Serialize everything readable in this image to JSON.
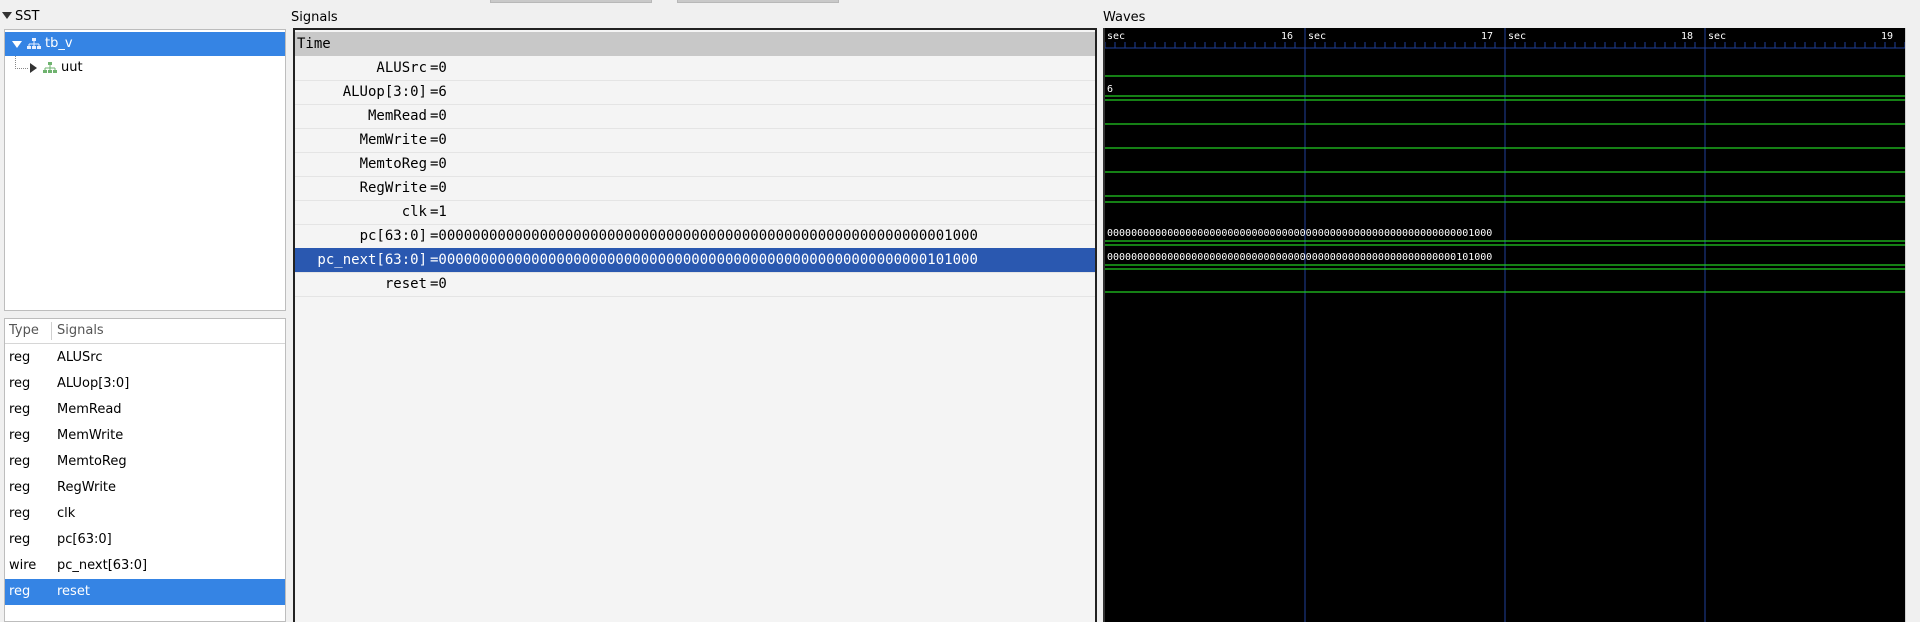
{
  "sst": {
    "title": "SST",
    "tree": [
      {
        "label": "tb_v",
        "selected": true,
        "expanded": true
      },
      {
        "label": "uut",
        "selected": false,
        "expanded": false
      }
    ]
  },
  "signal_list": {
    "col_type": "Type",
    "col_signals": "Signals",
    "rows": [
      {
        "type": "reg",
        "name": "ALUSrc"
      },
      {
        "type": "reg",
        "name": "ALUop[3:0]"
      },
      {
        "type": "reg",
        "name": "MemRead"
      },
      {
        "type": "reg",
        "name": "MemWrite"
      },
      {
        "type": "reg",
        "name": "MemtoReg"
      },
      {
        "type": "reg",
        "name": "RegWrite"
      },
      {
        "type": "reg",
        "name": "clk"
      },
      {
        "type": "reg",
        "name": "pc[63:0]"
      },
      {
        "type": "wire",
        "name": "pc_next[63:0]"
      },
      {
        "type": "reg",
        "name": "reset",
        "selected": true
      }
    ]
  },
  "signals_pane": {
    "label": "Signals",
    "time_label": "Time",
    "rows": [
      {
        "name": "ALUSrc",
        "value": "=0"
      },
      {
        "name": "ALUop[3:0]",
        "value": "=6"
      },
      {
        "name": "MemRead",
        "value": "=0"
      },
      {
        "name": "MemWrite",
        "value": "=0"
      },
      {
        "name": "MemtoReg",
        "value": "=0"
      },
      {
        "name": "RegWrite",
        "value": "=0"
      },
      {
        "name": "clk",
        "value": "=1"
      },
      {
        "name": "pc[63:0]",
        "value": "=0000000000000000000000000000000000000000000000000000000000001000"
      },
      {
        "name": "pc_next[63:0]",
        "value": "=0000000000000000000000000000000000000000000000000000000000101000",
        "selected": true
      },
      {
        "name": "reset",
        "value": "=0"
      }
    ]
  },
  "waves_pane": {
    "label": "Waves",
    "time_markers": [
      {
        "label": "sec",
        "num": "16"
      },
      {
        "label": "sec",
        "num": "17"
      },
      {
        "label": "sec",
        "num": "18"
      },
      {
        "label": "sec",
        "num": "19"
      }
    ],
    "bus_labels": {
      "alu_op": "6",
      "pc": "0000000000000000000000000000000000000000000000000000000000001000",
      "pc_next": "0000000000000000000000000000000000000000000000000000000000101000"
    },
    "colors": {
      "trace": "#22cc22",
      "background": "#000000",
      "marker": "#1f3f9a",
      "text": "#ffffff"
    }
  }
}
